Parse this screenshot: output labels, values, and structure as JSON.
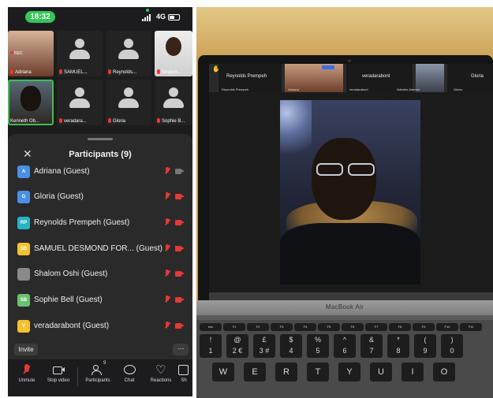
{
  "phone": {
    "status": {
      "time": "18:32",
      "network": "4G"
    },
    "tiles": [
      {
        "name": "Adriana",
        "rec": "REC",
        "kind": "photo"
      },
      {
        "name": "SAMUEL...",
        "kind": "avatar"
      },
      {
        "name": "Reynolds...",
        "kind": "avatar"
      },
      {
        "name": "Shalom...",
        "kind": "photo"
      },
      {
        "name": "Kenneth Ob...",
        "kind": "photo"
      },
      {
        "name": "veradara...",
        "kind": "avatar"
      },
      {
        "name": "Gloria",
        "kind": "avatar"
      },
      {
        "name": "Sophie B...",
        "kind": "avatar"
      }
    ],
    "participants": {
      "title": "Participants (9)",
      "close_icon": "close-icon",
      "list": [
        {
          "initials": "A",
          "color": "#4a90e2",
          "name": "Adriana (Guest)"
        },
        {
          "initials": "G",
          "color": "#4a90e2",
          "name": "Gloria (Guest)"
        },
        {
          "initials": "RP",
          "color": "#27b3c6",
          "name": "Reynolds Prempeh (Guest)"
        },
        {
          "initials": "SD",
          "color": "#f2c230",
          "name": "SAMUEL DESMOND FOR... (Guest)"
        },
        {
          "initials": "",
          "color": "#8a8a8a",
          "name": "Shalom Oshi (Guest)"
        },
        {
          "initials": "SB",
          "color": "#6cc070",
          "name": "Sophie Bell (Guest)"
        },
        {
          "initials": "V",
          "color": "#f2c230",
          "name": "veradarabont (Guest)"
        }
      ],
      "invite": "Invite",
      "more": "···"
    },
    "toolbar": {
      "unmute": "Unmute",
      "stop_video": "Stop video",
      "participants": "Participants",
      "participants_count": "9",
      "chat": "Chat",
      "reactions": "Reactions",
      "share": "Sh"
    }
  },
  "photo": {
    "strip": {
      "reynolds": "Reynolds Prempeh",
      "reynolds_small": "Reynolds Prempeh",
      "adriana_small": "Adriana",
      "veradara": "veradarabont",
      "veradara_small": "veradarabont",
      "kenneth_small": "Adenike Ademol",
      "gloria": "Gloria",
      "gloria_small": "Gloria"
    },
    "brand": "MacBook Air",
    "fn_keys": [
      "esc",
      "F1",
      "F2",
      "F3",
      "F4",
      "F5",
      "F6",
      "F7",
      "F8",
      "F9",
      "F10",
      "F11",
      "F12"
    ],
    "num_keys": [
      {
        "top": "!",
        "bot": "1"
      },
      {
        "top": "@",
        "bot": "2 €"
      },
      {
        "top": "£",
        "bot": "3 #"
      },
      {
        "top": "$",
        "bot": "4"
      },
      {
        "top": "%",
        "bot": "5"
      },
      {
        "top": "^",
        "bot": "6"
      },
      {
        "top": "&",
        "bot": "7"
      },
      {
        "top": "*",
        "bot": "8"
      },
      {
        "top": "(",
        "bot": "9"
      },
      {
        "top": ")",
        "bot": "0"
      }
    ],
    "letter_keys": [
      "W",
      "E",
      "R",
      "T",
      "Y",
      "U",
      "I",
      "O"
    ]
  }
}
